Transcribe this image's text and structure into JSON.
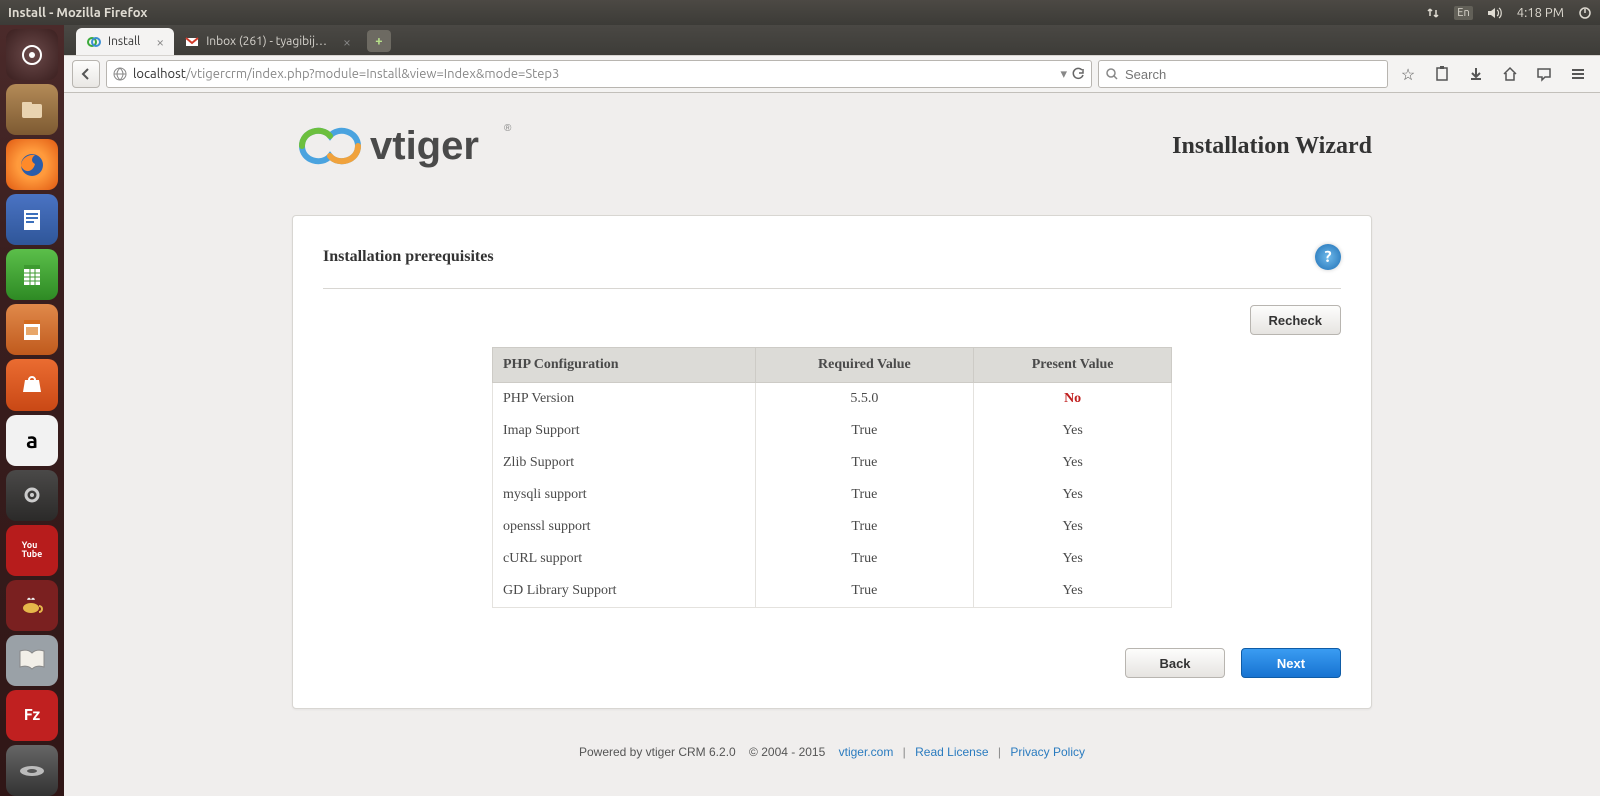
{
  "menubar": {
    "title": "Install - Mozilla Firefox",
    "lang": "En",
    "time": "4:18 PM"
  },
  "tabs": [
    {
      "label": "Install",
      "active": true
    },
    {
      "label": "Inbox (261) - tyagibij…",
      "active": false
    }
  ],
  "addressbar": {
    "host": "localhost",
    "path": "/vtigercrm/index.php?module=Install&view=Index&mode=Step3"
  },
  "search": {
    "placeholder": "Search"
  },
  "page": {
    "wizard_title": "Installation Wizard",
    "panel_title": "Installation prerequisites",
    "recheck_label": "Recheck",
    "table": {
      "headers": {
        "c1": "PHP Configuration",
        "c2": "Required Value",
        "c3": "Present Value"
      },
      "rows": [
        {
          "name": "PHP Version",
          "required": "5.5.0",
          "present": "No",
          "present_ok": false
        },
        {
          "name": "Imap Support",
          "required": "True",
          "present": "Yes",
          "present_ok": true
        },
        {
          "name": "Zlib Support",
          "required": "True",
          "present": "Yes",
          "present_ok": true
        },
        {
          "name": "mysqli support",
          "required": "True",
          "present": "Yes",
          "present_ok": true
        },
        {
          "name": "openssl support",
          "required": "True",
          "present": "Yes",
          "present_ok": true
        },
        {
          "name": "cURL support",
          "required": "True",
          "present": "Yes",
          "present_ok": true
        },
        {
          "name": "GD Library Support",
          "required": "True",
          "present": "Yes",
          "present_ok": true
        }
      ]
    },
    "back_label": "Back",
    "next_label": "Next",
    "footer": {
      "powered": "Powered by vtiger CRM 6.2.0",
      "copyright": "© 2004 - 2015",
      "link_site": "vtiger.com",
      "link_license": "Read License",
      "link_privacy": "Privacy Policy"
    }
  },
  "launcher": {
    "items": [
      "dash",
      "files",
      "firefox",
      "writer",
      "calc",
      "impress",
      "software-center",
      "amazon",
      "settings",
      "youtube",
      "tea",
      "dictionary",
      "filezilla",
      "devices"
    ]
  }
}
